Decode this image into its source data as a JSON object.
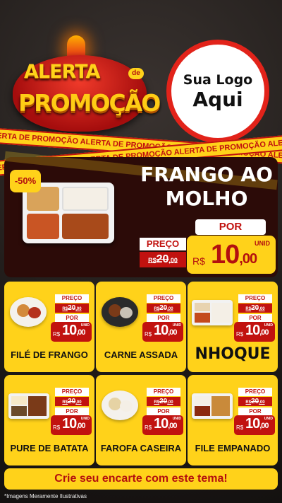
{
  "header": {
    "alert_word": "ALERTA",
    "de": "de",
    "promo_word": "PROMOÇÃO",
    "logo_line1": "Sua Logo",
    "logo_line2": "Aqui"
  },
  "tape_text": "ALERTA DE PROMOÇÃO   ALERTA DE PROMOÇÃO   ALERTA DE PROMOÇÃO   ALERTA DE PROMOÇÃO",
  "featured": {
    "discount": "-50%",
    "name": "FRANGO AO MOLHO",
    "por": "POR",
    "preco_label": "PREÇO",
    "old_currency": "R$",
    "old_int": "20",
    "old_dec": ",00",
    "unit": "UNID",
    "currency": "R$",
    "price_int": "10",
    "price_dec": ",00"
  },
  "price_labels": {
    "preco": "PREÇO",
    "por": "POR",
    "unid": "UNID",
    "currency": "R$",
    "old_int": "20",
    "old_dec": ",00",
    "new_int": "10",
    "new_dec": ",00"
  },
  "products": [
    {
      "name": "FILÉ DE FRANGO"
    },
    {
      "name": "CARNE ASSADA"
    },
    {
      "name": "NHOQUE"
    },
    {
      "name": "PURE DE BATATA"
    },
    {
      "name": "FAROFA CASEIRA"
    },
    {
      "name": "FILE EMPANADO"
    }
  ],
  "cta": "Crie seu encarte com este tema!",
  "note": "*Imagens Meramente Ilustrativas",
  "colors": {
    "accent": "#ffd21a",
    "red": "#c1120f",
    "dark": "#2c0b08"
  }
}
